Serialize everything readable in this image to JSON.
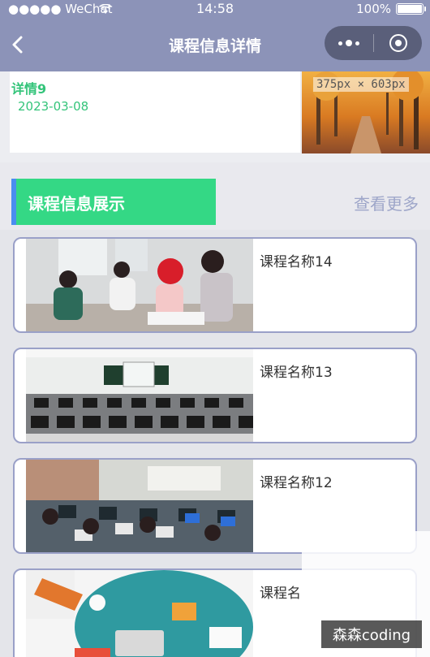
{
  "status_bar": {
    "carrier": "●●●●● WeChat",
    "time": "14:58",
    "battery": "100%"
  },
  "nav": {
    "title": "课程信息详情"
  },
  "detail": {
    "title": "详情9",
    "date": "2023-03-08",
    "size_tip": "375px × 603px"
  },
  "section": {
    "title": "课程信息展示",
    "more": "查看更多"
  },
  "courses": [
    {
      "name": "课程名称14"
    },
    {
      "name": "课程名称13"
    },
    {
      "name": "课程名称12"
    },
    {
      "name": "课程名"
    }
  ],
  "watermark": "森森coding",
  "colors": {
    "nav_bg": "#8c93b8",
    "accent_green": "#34d885",
    "accent_blue": "#4a8df0",
    "card_border": "#9aa0c8"
  }
}
